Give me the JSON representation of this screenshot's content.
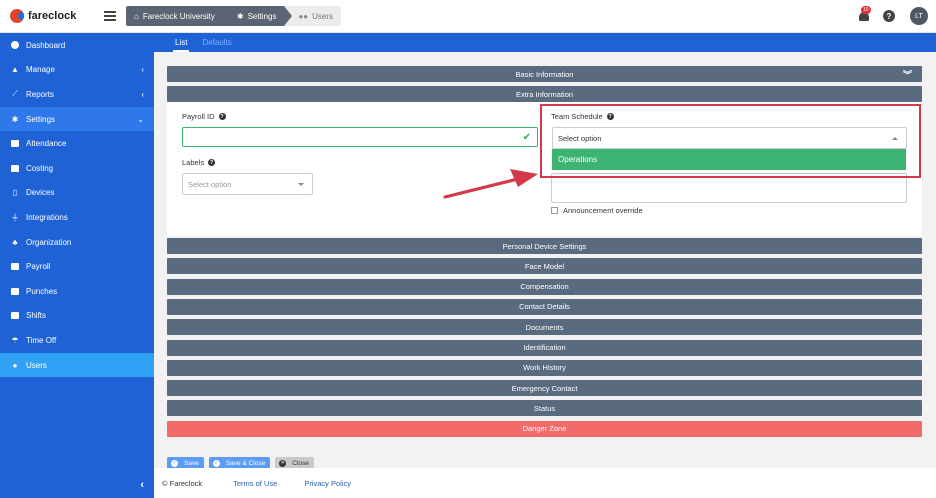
{
  "brand": {
    "name": "fareclock"
  },
  "breadcrumb": [
    {
      "label": "Fareclock University",
      "icon": "home-icon"
    },
    {
      "label": "Settings",
      "icon": "gear-icon"
    },
    {
      "label": "Users",
      "icon": "users-icon"
    }
  ],
  "header": {
    "notification_count": "10",
    "help_label": "?",
    "avatar_initials": "LT"
  },
  "sidebar": {
    "items": [
      {
        "label": "Dashboard",
        "icon": "dashboard-icon"
      },
      {
        "label": "Manage",
        "icon": "person-icon",
        "chevron": "‹"
      },
      {
        "label": "Reports",
        "icon": "chart-icon",
        "chevron": "‹"
      },
      {
        "label": "Settings",
        "icon": "gear-icon",
        "chevron": "⌄"
      },
      {
        "label": "Attendance",
        "icon": "calendar-icon"
      },
      {
        "label": "Costing",
        "icon": "factory-icon"
      },
      {
        "label": "Devices",
        "icon": "tablet-icon"
      },
      {
        "label": "Integrations",
        "icon": "plug-icon"
      },
      {
        "label": "Organization",
        "icon": "sitemap-icon"
      },
      {
        "label": "Payroll",
        "icon": "money-icon"
      },
      {
        "label": "Punches",
        "icon": "truck-icon"
      },
      {
        "label": "Shifts",
        "icon": "briefcase-icon"
      },
      {
        "label": "Time Off",
        "icon": "umbrella-beach-icon"
      },
      {
        "label": "Users",
        "icon": "users-icon"
      }
    ],
    "collapse_label": "‹"
  },
  "tabs": {
    "list": "List",
    "defaults": "Defaults"
  },
  "sections": {
    "basic_information": "Basic Information",
    "extra_information": "Extra Information",
    "personal_device_settings": "Personal Device Settings",
    "face_model": "Face Model",
    "compensation": "Compensation",
    "contact_details": "Contact Details",
    "documents": "Documents",
    "identification": "Identification",
    "work_history": "Work History",
    "emergency_contact": "Emergency Contact",
    "status": "Status",
    "danger_zone": "Danger Zone"
  },
  "form": {
    "payroll_id_label": "Payroll ID",
    "payroll_id_value": "",
    "labels_label": "Labels",
    "labels_placeholder": "Select option",
    "team_schedule_label": "Team Schedule",
    "team_schedule_placeholder": "Select option",
    "team_schedule_option": "Operations",
    "announcement_override_label": "Announcement override"
  },
  "actions": {
    "save": "Save",
    "save_close": "Save & Close",
    "close": "Close"
  },
  "footer": {
    "copyright": "© Fareclock",
    "terms": "Terms of Use",
    "privacy": "Privacy Policy"
  },
  "colors": {
    "sidebar": "#1f62d6",
    "active_nav": "#31a1f5",
    "section_bar": "#5a6b7f",
    "danger": "#f26b6a",
    "valid": "#3cb371",
    "highlight": "#d23a4b"
  }
}
